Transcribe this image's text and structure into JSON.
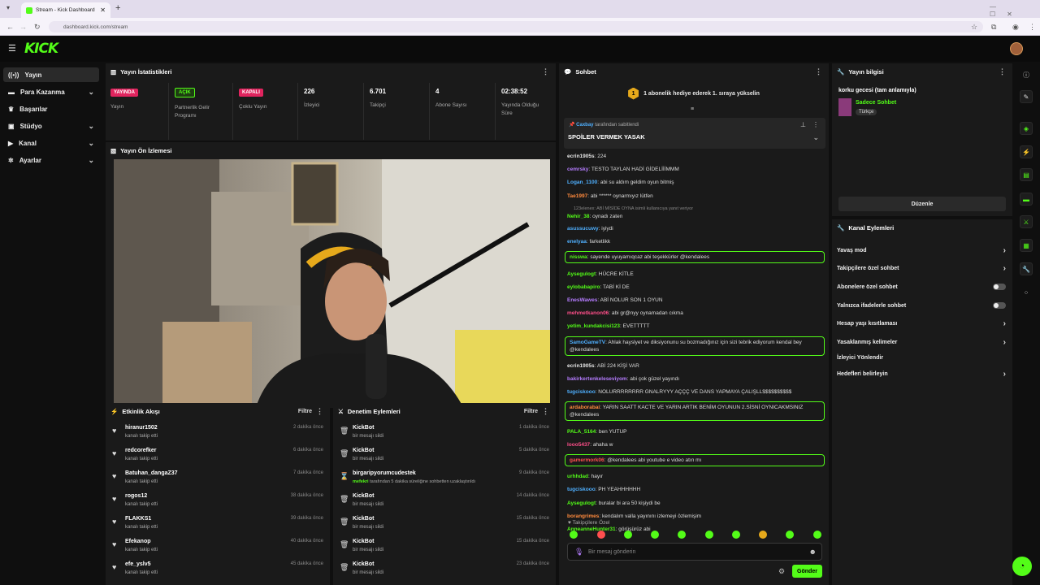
{
  "browser": {
    "tab_title": "Stream - Kick Dashboard",
    "url": "dashboard.kick.com/stream"
  },
  "brand": {
    "logo": "KICK",
    "accent": "#53fc18"
  },
  "sidebar": {
    "items": [
      {
        "label": "Yayın",
        "icon": "broadcast-icon",
        "active": true
      },
      {
        "label": "Para Kazanma",
        "icon": "money-icon",
        "chevron": true
      },
      {
        "label": "Başarılar",
        "icon": "trophy-icon"
      },
      {
        "label": "Stüdyo",
        "icon": "studio-icon",
        "chevron": true
      },
      {
        "label": "Kanal",
        "icon": "channel-icon",
        "chevron": true
      },
      {
        "label": "Ayarlar",
        "icon": "gear-icon",
        "chevron": true
      }
    ]
  },
  "stats": {
    "title": "Yayın İstatistikleri",
    "items": [
      {
        "badge": "YAYINDA",
        "badge_color": "#e0245e",
        "label": "Yayın"
      },
      {
        "badge": "AÇIK",
        "badge_color": "#53fc18",
        "label": "Partnerlik Gelir Programı"
      },
      {
        "badge": "KAPALI",
        "badge_color": "#e0245e",
        "label": "Çoklu Yayın"
      },
      {
        "value": "226",
        "label": "İzleyici"
      },
      {
        "value": "6.701",
        "label": "Takipçi"
      },
      {
        "value": "4",
        "label": "Abone Sayısı"
      },
      {
        "value": "02:38:52",
        "label": "Yayında Olduğu Süre"
      }
    ]
  },
  "preview": {
    "title": "Yayın Ön İzlemesi"
  },
  "activity": {
    "title": "Etkinlik Akışı",
    "filter": "Filtre",
    "rows": [
      {
        "name": "hiranur1502",
        "desc": "kanalı takip etti",
        "time": "2 dakika önce"
      },
      {
        "name": "redcorefker",
        "desc": "kanalı takip etti",
        "time": "6 dakika önce"
      },
      {
        "name": "Batuhan_dangaZ37",
        "desc": "kanalı takip etti",
        "time": "7 dakika önce"
      },
      {
        "name": "rogos12",
        "desc": "kanalı takip etti",
        "time": "38 dakika önce"
      },
      {
        "name": "FLAKKS1",
        "desc": "kanalı takip etti",
        "time": "39 dakika önce"
      },
      {
        "name": "Efekanop",
        "desc": "kanalı takip etti",
        "time": "40 dakika önce"
      },
      {
        "name": "efe_yslv5",
        "desc": "kanalı takip etti",
        "time": "45 dakika önce"
      }
    ]
  },
  "moderation": {
    "title": "Denetim Eylemleri",
    "filter": "Filtre",
    "rows": [
      {
        "name": "KickBot",
        "desc": "bir mesajı sildi",
        "time": "1 dakika önce",
        "icon": "trash-icon"
      },
      {
        "name": "KickBot",
        "desc": "bir mesajı sildi",
        "time": "5 dakika önce",
        "icon": "trash-icon"
      },
      {
        "name": "birgaripyorumcudestek",
        "desc_user": "mefekri",
        "desc": "tarafından 5 dakika süreliğine sohbetten uzaklaştırıldı",
        "time": "9 dakika önce",
        "icon": "hourglass-icon"
      },
      {
        "name": "KickBot",
        "desc": "bir mesajı sildi",
        "time": "14 dakika önce",
        "icon": "trash-icon"
      },
      {
        "name": "KickBot",
        "desc": "bir mesajı sildi",
        "time": "15 dakika önce",
        "icon": "trash-icon"
      },
      {
        "name": "KickBot",
        "desc": "bir mesajı sildi",
        "time": "15 dakika önce",
        "icon": "trash-icon"
      },
      {
        "name": "KickBot",
        "desc": "bir mesajı sildi",
        "time": "23 dakika önce",
        "icon": "trash-icon"
      }
    ]
  },
  "chat": {
    "title": "Sohbet",
    "gift_banner": "1 abonelik hediye ederek 1. sıraya yükselin",
    "gift_rank": "1",
    "pinned_by_user": "Caxbay",
    "pinned_by_suffix": "tarafından sabitlendi",
    "pinned_text": "SPOİLER VERMEK YASAK",
    "followers_only_label": "Takipçilere Özel",
    "input_placeholder": "Bir mesaj gönderin",
    "send_label": "Gönder",
    "messages": [
      {
        "user": "ecrin1905s",
        "color": "#e8e8e8",
        "text": "224"
      },
      {
        "user": "cemrsky",
        "color": "#b57cff",
        "text": "TESTO TAYLAN HADİ GİDELİİİMMM"
      },
      {
        "user": "Logan_1100",
        "color": "#4fb0ff",
        "text": "abi su aldım geldim oyun bitmiş"
      },
      {
        "user": "Tae1997",
        "color": "#ff8a3d",
        "text": "abi ****** oynarmıyız lütfen"
      },
      {
        "user": "Nehir_38",
        "color": "#53fc18",
        "text": "oynadı zaten",
        "reply": "123elenex: ABİ MİSİDE OYNA isimli kullanıcıya yanıt veriyor"
      },
      {
        "user": "asussucuwy",
        "color": "#4fb0ff",
        "text": "iyiydi"
      },
      {
        "user": "enelyaa",
        "color": "#4fb0ff",
        "text": "farketlikk"
      },
      {
        "user": "nisswa",
        "color": "#53fc18",
        "text": "sayende uyuyamıqcaz abi teşekkürler @kendalees",
        "highlight": true
      },
      {
        "user": "Aysegulogt",
        "color": "#53fc18",
        "text": "HÜCRE KİTLE"
      },
      {
        "user": "eylobabapiro",
        "color": "#53fc18",
        "text": "TABİ Kİ DE"
      },
      {
        "user": "EnesWawes",
        "color": "#b57cff",
        "text": "ABİ NOLUR SON 1 OYUN"
      },
      {
        "user": "mehmetkanon06",
        "color": "#ff4f8a",
        "text": "abi gr@nyy oynamadan cıkma"
      },
      {
        "user": "yetim_kundakcisi123",
        "color": "#53fc18",
        "text": "EVETTTTT"
      },
      {
        "user": "SamoGameTV",
        "color": "#4fb0ff",
        "text": "Ahlak hayslyet ve diksiyonunu su bozmadığınız için sizi tebrik ediyorum kendal bey @kendalees",
        "highlight": true
      },
      {
        "user": "ecrin1905s",
        "color": "#e8e8e8",
        "text": "ABİ 224 KİŞİ VAR"
      },
      {
        "user": "bakirkertenkeleseviyom",
        "color": "#b57cff",
        "text": "abi çok güzel yayındı"
      },
      {
        "user": "tugciskooo",
        "color": "#4fb0ff",
        "text": "NOLURRRRRRRR GNALRYYY AÇÇÇ VE DANS YAPMAYA ÇALIŞLL$$$$$$$$$$"
      },
      {
        "user": "ardaborabai",
        "color": "#ff8a3d",
        "text": "YARIN SAATT KACTE VE YARIN ARTIK BENİM OYUNUN 2.SİSNİ OYNICAKMSINIZ @kendalees",
        "highlight": true
      },
      {
        "user": "PALA_5164",
        "color": "#53fc18",
        "text": "ben YUTUP"
      },
      {
        "user": "looo5437",
        "color": "#ff4f8a",
        "text": "ahaha w"
      },
      {
        "user": "gamermork06",
        "color": "#ff4f4f",
        "text": "@kendalees abi youtube e video atın mı",
        "highlight": true
      },
      {
        "user": "urhhdad",
        "color": "#53fc18",
        "text": "hayır"
      },
      {
        "user": "tugciskooo",
        "color": "#4fb0ff",
        "text": "PH YEAHHHHHH"
      },
      {
        "user": "Aysegulogt",
        "color": "#53fc18",
        "text": "buralar bi ara 50 kişiydi be"
      },
      {
        "user": "borangrimes",
        "color": "#ff8a3d",
        "text": "kendalım valla yayınını izlemeyi özlemişim"
      },
      {
        "user": "AnneanneHunter31",
        "color": "#53fc18",
        "text": "görüşürüz abi"
      }
    ]
  },
  "stream_info": {
    "title": "Yayın bilgisi",
    "stream_title": "korku gecesi (tam anlamıyla)",
    "category": "Sadece Sohbet",
    "language": "Türkçe",
    "edit_label": "Düzenle"
  },
  "channel_actions": {
    "title": "Kanal Eylemleri",
    "items": [
      {
        "label": "Yavaş mod",
        "control": "arrow"
      },
      {
        "label": "Takipçilere özel sohbet",
        "control": "arrow"
      },
      {
        "label": "Abonelere özel sohbet",
        "control": "toggle",
        "on": false
      },
      {
        "label": "Yalnızca ifadelerle sohbet",
        "control": "toggle",
        "on": false
      },
      {
        "label": "Hesap yaşı kısıtlaması",
        "control": "arrow"
      },
      {
        "label": "Yasaklanmış kelimeler",
        "control": "arrow"
      },
      {
        "label": "İzleyici Yönlendir",
        "control": "none"
      },
      {
        "label": "Hedefleri belirleyin",
        "control": "arrow"
      }
    ]
  }
}
